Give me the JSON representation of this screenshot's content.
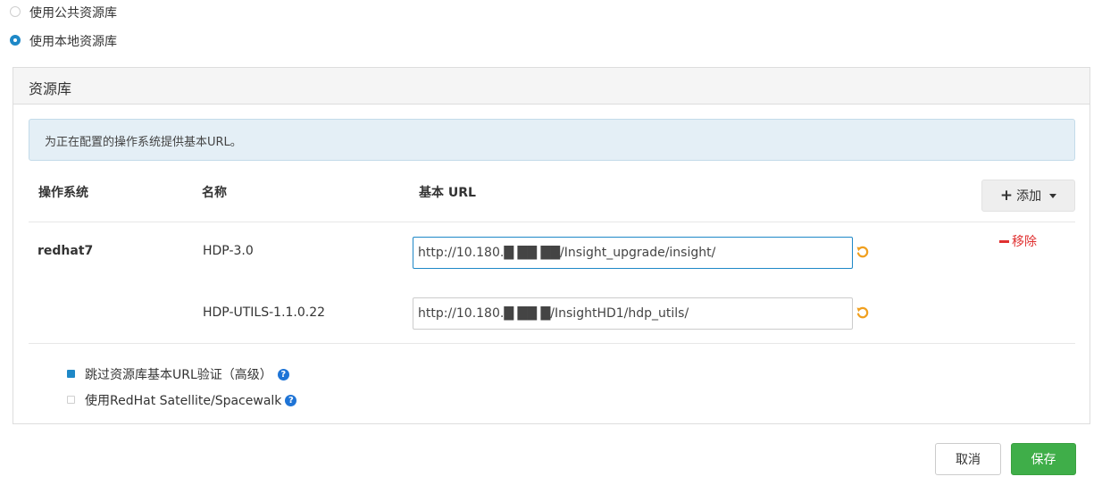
{
  "repo_source": {
    "public_label": "使用公共资源库",
    "local_label": "使用本地资源库",
    "selected": "local"
  },
  "panel": {
    "title": "资源库",
    "info": "为正在配置的操作系统提供基本URL。"
  },
  "table": {
    "headers": {
      "os": "操作系统",
      "name": "名称",
      "base_url": "基本 URL"
    },
    "add_label": "添加",
    "remove_label": "移除",
    "os": "redhat7",
    "rows": [
      {
        "name": "HDP-3.0",
        "url": "http://10.180.█ ██ ██/Insight_upgrade/insight/"
      },
      {
        "name": "HDP-UTILS-1.1.0.22",
        "url": "http://10.180.█ ██ █/InsightHD1/hdp_utils/"
      }
    ]
  },
  "options": {
    "skip_validation_label": "跳过资源库基本URL验证（高级）",
    "skip_validation_checked": true,
    "satellite_label": "使用RedHat Satellite/Spacewalk",
    "satellite_checked": false
  },
  "actions": {
    "cancel": "取消",
    "save": "保存"
  },
  "colors": {
    "accent": "#1e88c7",
    "save_green": "#3fae49",
    "remove_red": "#e03030",
    "undo_orange": "#f0a020",
    "help_blue": "#1e74d6"
  }
}
